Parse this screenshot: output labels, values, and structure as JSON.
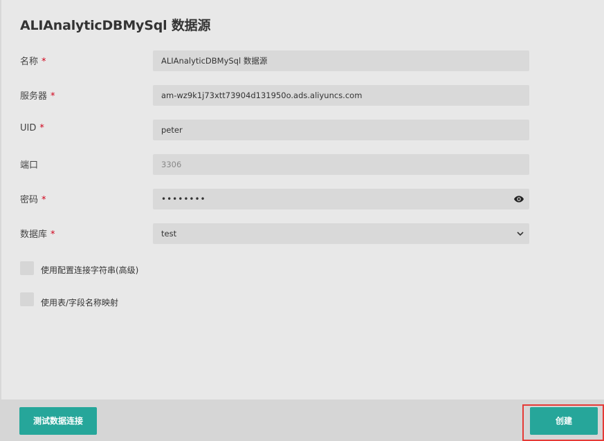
{
  "page": {
    "title": "ALIAnalyticDBMySql 数据源"
  },
  "form": {
    "name": {
      "label": "名称",
      "required": "*",
      "value": "ALIAnalyticDBMySql 数据源"
    },
    "server": {
      "label": "服务器",
      "required": "*",
      "value": "am-wz9k1j73xtt73904d131950o.ads.aliyuncs.com"
    },
    "uid": {
      "label": "UID",
      "required": "*",
      "value": "peter"
    },
    "port": {
      "label": "端口",
      "placeholder": "3306"
    },
    "password": {
      "label": "密码",
      "required": "*",
      "masked_value": "••••••••",
      "icon": "eye-icon"
    },
    "database": {
      "label": "数据库",
      "required": "*",
      "selected": "test",
      "icon": "chevron-down-icon"
    },
    "use_conn_string": {
      "label": "使用配置连接字符串(高级)",
      "checked": false
    },
    "use_mapping": {
      "label": "使用表/字段名称映射",
      "checked": false
    }
  },
  "footer": {
    "test_button": "测试数据连接",
    "create_button": "创建"
  },
  "colors": {
    "accent": "#26a69a",
    "required": "#d0021b",
    "highlight": "#e53935",
    "background": "#e8e8e8",
    "field": "#d9d9d9"
  }
}
